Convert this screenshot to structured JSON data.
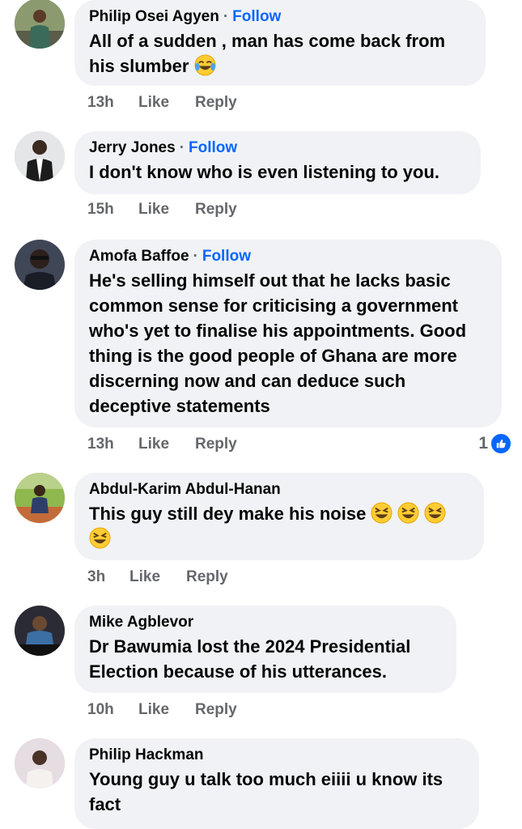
{
  "comments": [
    {
      "name": "Philip Osei Agyen",
      "follow": "Follow",
      "text": "All of a sudden , man has come back from his slumber",
      "time": "13h",
      "like": "Like",
      "reply": "Reply"
    },
    {
      "name": "Jerry Jones",
      "follow": "Follow",
      "text": "I don't know who is even listening to you.",
      "time": "15h",
      "like": "Like",
      "reply": "Reply"
    },
    {
      "name": "Amofa Baffoe",
      "follow": "Follow",
      "text": "He's selling himself out that he lacks basic common sense for criticising a government who's yet to finalise his appointments. Good thing is the good people of Ghana are more discerning now and can deduce such deceptive statements",
      "time": "13h",
      "like": "Like",
      "reply": "Reply",
      "reaction_count": "1"
    },
    {
      "name": "Abdul-Karim Abdul-Hanan",
      "text": "This guy still dey make his noise",
      "time": "3h",
      "like": "Like",
      "reply": "Reply"
    },
    {
      "name": "Mike Agblevor",
      "text": "Dr Bawumia lost the 2024 Presidential Election because of his utterances.",
      "time": "10h",
      "like": "Like",
      "reply": "Reply"
    },
    {
      "name": "Philip Hackman",
      "text": "Young guy u talk too much eiiii u know its fact"
    }
  ],
  "avatar_colors": [
    "#5b6b4a",
    "#dfe3e6",
    "#4a4f5c",
    "#6f8f3f",
    "#4b3a2e",
    "#d9cfd8"
  ],
  "colors": {
    "follow": "#0866ff",
    "bubble": "#f0f2f5",
    "meta": "#65676b",
    "like_badge": "#0866ff"
  }
}
